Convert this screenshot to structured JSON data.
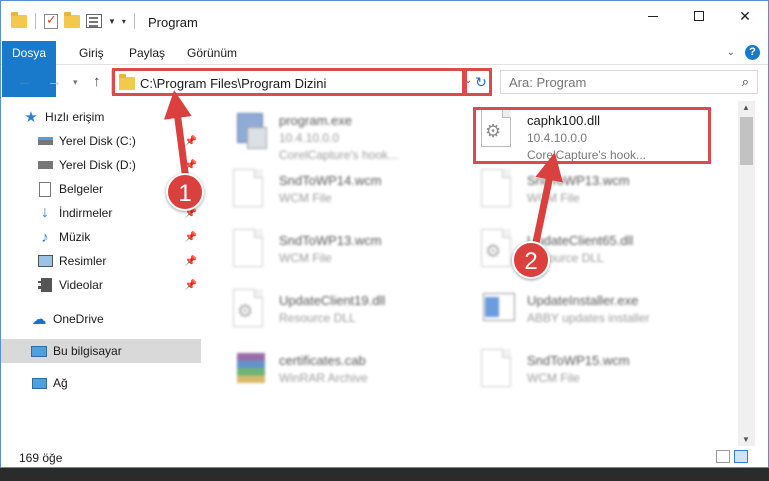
{
  "window": {
    "title": "Program"
  },
  "ribbon": {
    "tabs": [
      "Dosya",
      "Giriş",
      "Paylaş",
      "Görünüm"
    ]
  },
  "address": {
    "path": "C:\\Program Files\\Program Dizini",
    "search_placeholder": "Ara: Program"
  },
  "sidebar": {
    "items": [
      {
        "label": "Hızlı erişim",
        "icon": "star-icon"
      },
      {
        "label": "Yerel Disk (C:)",
        "icon": "drive-icon"
      },
      {
        "label": "Yerel Disk (D:)",
        "icon": "drive-icon"
      },
      {
        "label": "Belgeler",
        "icon": "documents-icon"
      },
      {
        "label": "İndirmeler",
        "icon": "download-icon"
      },
      {
        "label": "Müzik",
        "icon": "music-icon"
      },
      {
        "label": "Resimler",
        "icon": "pictures-icon"
      },
      {
        "label": "Videolar",
        "icon": "video-icon"
      },
      {
        "label": "OneDrive",
        "icon": "cloud-icon"
      },
      {
        "label": "Bu bilgisayar",
        "icon": "computer-icon"
      },
      {
        "label": "Ağ",
        "icon": "network-icon"
      }
    ]
  },
  "files": [
    {
      "name": "program.exe",
      "line2": "10.4.10.0.0",
      "line3": "CorelCapture's hook...",
      "icon": "exe-icon"
    },
    {
      "name": "caphk100.dll",
      "line2": "10.4.10.0.0",
      "line3": "CorelCapture's hook...",
      "icon": "dll-icon"
    },
    {
      "name": "SndToWP14.wcm",
      "line2": "WCM File",
      "line3": "",
      "icon": "file-icon"
    },
    {
      "name": "SndToWP13.wcm",
      "line2": "WCM File",
      "line3": "",
      "icon": "file-icon"
    },
    {
      "name": "SndToWP13.wcm",
      "line2": "WCM File",
      "line3": "",
      "icon": "file-icon"
    },
    {
      "name": "UpdateClient65.dll",
      "line2": "Resource DLL",
      "line3": "",
      "icon": "dll-icon"
    },
    {
      "name": "UpdateClient19.dll",
      "line2": "Resource DLL",
      "line3": "",
      "icon": "dll-icon"
    },
    {
      "name": "UpdateInstaller.exe",
      "line2": "ABBY updates installer",
      "line3": "",
      "icon": "installer-icon"
    },
    {
      "name": "certificates.cab",
      "line2": "WinRAR Archive",
      "line3": "",
      "icon": "archive-icon"
    },
    {
      "name": "SndToWP15.wcm",
      "line2": "WCM File",
      "line3": "",
      "icon": "file-icon"
    }
  ],
  "status": {
    "count": "169 öğe"
  },
  "markers": [
    "1",
    "2"
  ],
  "colors": {
    "accent": "#1979ca",
    "highlight": "#dc4b4b",
    "marker": "#d9403e"
  }
}
